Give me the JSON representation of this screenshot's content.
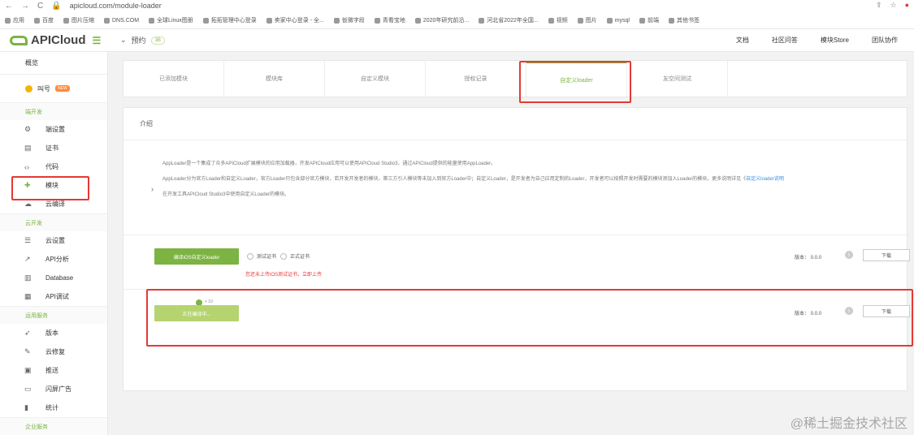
{
  "browser": {
    "url": "apicloud.com/module-loader",
    "bookmarks": [
      "应用",
      "百度",
      "图片压缩",
      "DNS.COM",
      "全球Linux图册",
      "拓拓管理中心登录",
      "卖家中心登录 - 全...",
      "仮微字段",
      "青看宝地",
      "2020年研究前沿...",
      "河北省2022年全国...",
      "视频",
      "图片",
      "mysql",
      "前端",
      "其他书签"
    ]
  },
  "topbar": {
    "logo": "APICloud",
    "project_name": "预约",
    "project_badge": "3B",
    "links": [
      "文档",
      "社区问答",
      "模块Store",
      "团队协作"
    ]
  },
  "sidebar": {
    "overview": "概览",
    "app_name": "叫号",
    "app_badge": "NEW",
    "groups": [
      {
        "title": "端开发",
        "items": [
          {
            "icon": "gear-icon",
            "label": "端设置"
          },
          {
            "icon": "certificate-icon",
            "label": "证书"
          },
          {
            "icon": "code-icon",
            "label": "代码"
          },
          {
            "icon": "puzzle-icon",
            "label": "模块"
          },
          {
            "icon": "cloud-build-icon",
            "label": "云编译"
          }
        ]
      },
      {
        "title": "云开发",
        "items": [
          {
            "icon": "settings-list-icon",
            "label": "云设置"
          },
          {
            "icon": "chart-icon",
            "label": "API分析"
          },
          {
            "icon": "database-icon",
            "label": "Database"
          },
          {
            "icon": "api-test-icon",
            "label": "API调试"
          }
        ]
      },
      {
        "title": "运用服务",
        "items": [
          {
            "icon": "rocket-icon",
            "label": "版本"
          },
          {
            "icon": "wrench-icon",
            "label": "云修复"
          },
          {
            "icon": "push-icon",
            "label": "推送"
          },
          {
            "icon": "ad-icon",
            "label": "闪屏广告"
          },
          {
            "icon": "stats-icon",
            "label": "统计"
          }
        ]
      },
      {
        "title": "企业服务",
        "items": []
      }
    ]
  },
  "tabs": [
    "已添加模块",
    "模块库",
    "自定义模块",
    "授权记录",
    "自定义loader",
    "友空间测试"
  ],
  "active_tab_index": 4,
  "panel": {
    "title": "介绍",
    "desc": [
      "AppLoader是一个集成了众多APICloud扩展模块的应用加载器，开发APICloud应用可以使用APICloud Studio3，通过APICloud提供的能量使用AppLoader。",
      "AppLoader分为官方Loader和自定义Loader，官方Loader只包含部分官方模块，若开发开发者的模块，第三方引人模块等未加入到官方Loader中；自定义Loader，是开发者为自己应用定制的Loader，开发者可以按照开发时需要的模块添加入Loader的模块，更多说明详见《",
      "在开发工具APICloud Studio3中使用自定义Loader的模块。"
    ],
    "desc_link": "自定义loader说明",
    "row1": {
      "button": "编译iOS自定义loader",
      "radio1": "测试证书",
      "radio2": "正式证书",
      "warning": "您还未上传iOS测试证书，立即上传",
      "version_label": "版本：",
      "version": "0.0.0",
      "download": "下载"
    },
    "row2": {
      "button": "正在编译中...",
      "progress": "+ 10",
      "version_label": "版本：",
      "version": "0.0.0",
      "download": "下载"
    }
  },
  "watermark": "@稀土掘金技术社区"
}
